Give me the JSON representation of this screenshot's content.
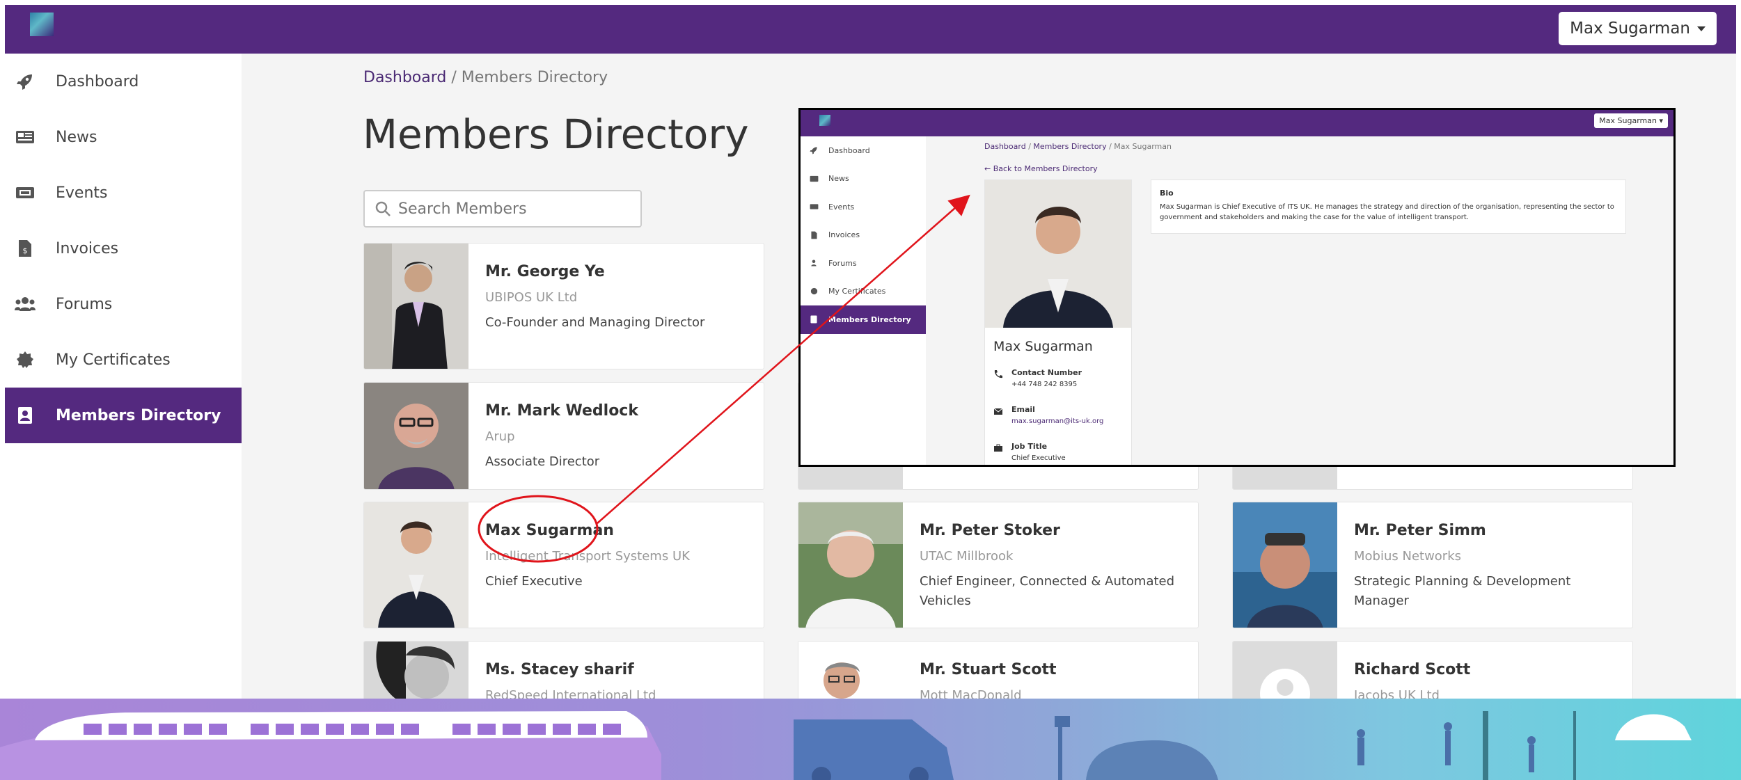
{
  "header": {
    "user_name": "Max Sugarman"
  },
  "sidebar": {
    "items": [
      {
        "label": "Dashboard",
        "icon": "rocket-icon"
      },
      {
        "label": "News",
        "icon": "newspaper-icon"
      },
      {
        "label": "Events",
        "icon": "ticket-icon"
      },
      {
        "label": "Invoices",
        "icon": "invoice-icon"
      },
      {
        "label": "Forums",
        "icon": "users-icon"
      },
      {
        "label": "My Certificates",
        "icon": "certificate-icon"
      },
      {
        "label": "Members Directory",
        "icon": "address-book-icon",
        "active": true
      }
    ]
  },
  "breadcrumb": {
    "home": "Dashboard",
    "sep": "/",
    "current": "Members Directory"
  },
  "page_title": "Members Directory",
  "search": {
    "placeholder": "Search Members"
  },
  "members": [
    {
      "name": "Mr. George Ye",
      "org": "UBIPOS UK Ltd",
      "role": "Co-Founder and Managing Director"
    },
    {
      "name": "Mr. Mark Wedlock",
      "org": "Arup",
      "role": "Associate Director"
    },
    {
      "name": "Max Sugarman",
      "org": "Intelligent Transport Systems UK",
      "role": "Chief Executive"
    },
    {
      "name": "Mr. Peter Stoker",
      "org": "UTAC Millbrook",
      "role": "Chief Engineer, Connected & Automated Vehicles"
    },
    {
      "name": "Mr. Peter Simm",
      "org": "Mobius Networks",
      "role": "Strategic Planning & Development Manager"
    },
    {
      "name": "Ms. Stacey sharif",
      "org": "RedSpeed International Ltd",
      "role": ""
    },
    {
      "name": "Mr. Stuart Scott",
      "org": "Mott MacDonald",
      "role": ""
    },
    {
      "name": "Richard Scott",
      "org": "Jacobs UK Ltd",
      "role": ""
    }
  ],
  "inset": {
    "user_name": "Max Sugarman",
    "breadcrumb": {
      "home": "Dashboard",
      "sep1": "/",
      "mid": "Members Directory",
      "sep2": "/",
      "current": "Max Sugarman"
    },
    "back_link": "← Back to Members Directory",
    "profile_name": "Max Sugarman",
    "contact_label": "Contact Number",
    "contact_value": "+44 748 242 8395",
    "email_label": "Email",
    "email_value": "max.sugarman@its-uk.org",
    "job_label": "Job Title",
    "job_value": "Chief Executive",
    "bio_label": "Bio",
    "bio_text": "Max Sugarman is Chief Executive of ITS UK. He manages the strategy and direction of the organisation, representing the sector to government and stakeholders and making the case for the value of intelligent transport."
  },
  "colors": {
    "brand": "#54297f",
    "annotation": "#e0141b"
  }
}
